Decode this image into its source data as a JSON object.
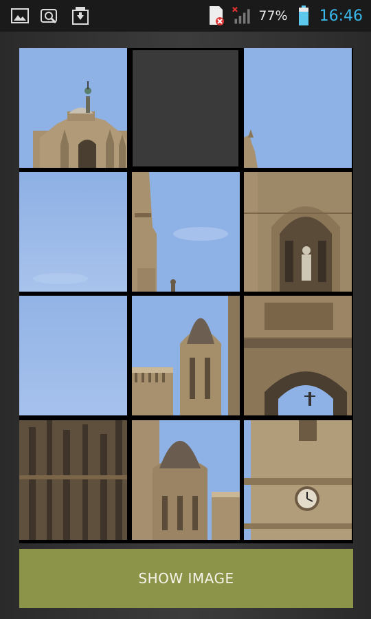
{
  "status_bar": {
    "icons": [
      "image-notification-icon",
      "search-notification-icon",
      "download-notification-icon",
      "sim-card-error-icon",
      "signal-no-service-icon",
      "battery-icon"
    ],
    "battery_percent": "77%",
    "time": "16:46"
  },
  "puzzle": {
    "rows": 4,
    "cols": 3,
    "empty_tile": 1,
    "tile_colors": {
      "sky": "#8fb2e6",
      "sky_light": "#a9c4ee",
      "stone": "#a7916f",
      "stone_dark": "#5b4c3a"
    }
  },
  "actions": {
    "show_image_label": "SHOW IMAGE"
  },
  "colors": {
    "button": "#8c9449",
    "clock": "#38b8e8"
  }
}
